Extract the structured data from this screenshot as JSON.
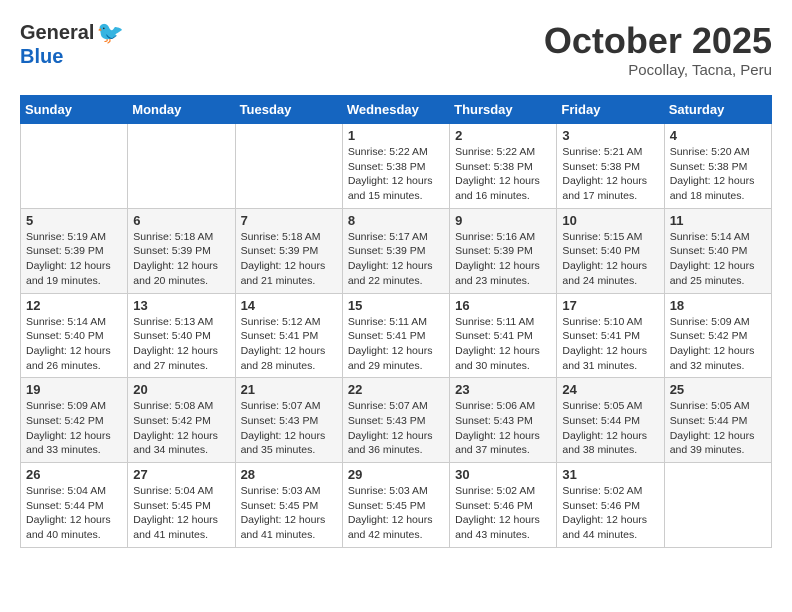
{
  "header": {
    "logo_general": "General",
    "logo_blue": "Blue",
    "month_title": "October 2025",
    "subtitle": "Pocollay, Tacna, Peru"
  },
  "days_of_week": [
    "Sunday",
    "Monday",
    "Tuesday",
    "Wednesday",
    "Thursday",
    "Friday",
    "Saturday"
  ],
  "weeks": [
    [
      {
        "day": "",
        "info": ""
      },
      {
        "day": "",
        "info": ""
      },
      {
        "day": "",
        "info": ""
      },
      {
        "day": "1",
        "info": "Sunrise: 5:22 AM\nSunset: 5:38 PM\nDaylight: 12 hours and 15 minutes."
      },
      {
        "day": "2",
        "info": "Sunrise: 5:22 AM\nSunset: 5:38 PM\nDaylight: 12 hours and 16 minutes."
      },
      {
        "day": "3",
        "info": "Sunrise: 5:21 AM\nSunset: 5:38 PM\nDaylight: 12 hours and 17 minutes."
      },
      {
        "day": "4",
        "info": "Sunrise: 5:20 AM\nSunset: 5:38 PM\nDaylight: 12 hours and 18 minutes."
      }
    ],
    [
      {
        "day": "5",
        "info": "Sunrise: 5:19 AM\nSunset: 5:39 PM\nDaylight: 12 hours and 19 minutes."
      },
      {
        "day": "6",
        "info": "Sunrise: 5:18 AM\nSunset: 5:39 PM\nDaylight: 12 hours and 20 minutes."
      },
      {
        "day": "7",
        "info": "Sunrise: 5:18 AM\nSunset: 5:39 PM\nDaylight: 12 hours and 21 minutes."
      },
      {
        "day": "8",
        "info": "Sunrise: 5:17 AM\nSunset: 5:39 PM\nDaylight: 12 hours and 22 minutes."
      },
      {
        "day": "9",
        "info": "Sunrise: 5:16 AM\nSunset: 5:39 PM\nDaylight: 12 hours and 23 minutes."
      },
      {
        "day": "10",
        "info": "Sunrise: 5:15 AM\nSunset: 5:40 PM\nDaylight: 12 hours and 24 minutes."
      },
      {
        "day": "11",
        "info": "Sunrise: 5:14 AM\nSunset: 5:40 PM\nDaylight: 12 hours and 25 minutes."
      }
    ],
    [
      {
        "day": "12",
        "info": "Sunrise: 5:14 AM\nSunset: 5:40 PM\nDaylight: 12 hours and 26 minutes."
      },
      {
        "day": "13",
        "info": "Sunrise: 5:13 AM\nSunset: 5:40 PM\nDaylight: 12 hours and 27 minutes."
      },
      {
        "day": "14",
        "info": "Sunrise: 5:12 AM\nSunset: 5:41 PM\nDaylight: 12 hours and 28 minutes."
      },
      {
        "day": "15",
        "info": "Sunrise: 5:11 AM\nSunset: 5:41 PM\nDaylight: 12 hours and 29 minutes."
      },
      {
        "day": "16",
        "info": "Sunrise: 5:11 AM\nSunset: 5:41 PM\nDaylight: 12 hours and 30 minutes."
      },
      {
        "day": "17",
        "info": "Sunrise: 5:10 AM\nSunset: 5:41 PM\nDaylight: 12 hours and 31 minutes."
      },
      {
        "day": "18",
        "info": "Sunrise: 5:09 AM\nSunset: 5:42 PM\nDaylight: 12 hours and 32 minutes."
      }
    ],
    [
      {
        "day": "19",
        "info": "Sunrise: 5:09 AM\nSunset: 5:42 PM\nDaylight: 12 hours and 33 minutes."
      },
      {
        "day": "20",
        "info": "Sunrise: 5:08 AM\nSunset: 5:42 PM\nDaylight: 12 hours and 34 minutes."
      },
      {
        "day": "21",
        "info": "Sunrise: 5:07 AM\nSunset: 5:43 PM\nDaylight: 12 hours and 35 minutes."
      },
      {
        "day": "22",
        "info": "Sunrise: 5:07 AM\nSunset: 5:43 PM\nDaylight: 12 hours and 36 minutes."
      },
      {
        "day": "23",
        "info": "Sunrise: 5:06 AM\nSunset: 5:43 PM\nDaylight: 12 hours and 37 minutes."
      },
      {
        "day": "24",
        "info": "Sunrise: 5:05 AM\nSunset: 5:44 PM\nDaylight: 12 hours and 38 minutes."
      },
      {
        "day": "25",
        "info": "Sunrise: 5:05 AM\nSunset: 5:44 PM\nDaylight: 12 hours and 39 minutes."
      }
    ],
    [
      {
        "day": "26",
        "info": "Sunrise: 5:04 AM\nSunset: 5:44 PM\nDaylight: 12 hours and 40 minutes."
      },
      {
        "day": "27",
        "info": "Sunrise: 5:04 AM\nSunset: 5:45 PM\nDaylight: 12 hours and 41 minutes."
      },
      {
        "day": "28",
        "info": "Sunrise: 5:03 AM\nSunset: 5:45 PM\nDaylight: 12 hours and 41 minutes."
      },
      {
        "day": "29",
        "info": "Sunrise: 5:03 AM\nSunset: 5:45 PM\nDaylight: 12 hours and 42 minutes."
      },
      {
        "day": "30",
        "info": "Sunrise: 5:02 AM\nSunset: 5:46 PM\nDaylight: 12 hours and 43 minutes."
      },
      {
        "day": "31",
        "info": "Sunrise: 5:02 AM\nSunset: 5:46 PM\nDaylight: 12 hours and 44 minutes."
      },
      {
        "day": "",
        "info": ""
      }
    ]
  ]
}
